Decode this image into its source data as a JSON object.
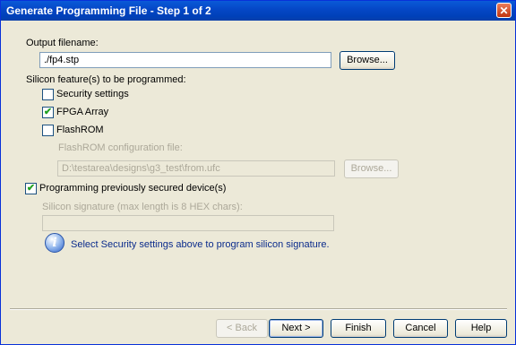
{
  "window": {
    "title": "Generate Programming File - Step 1 of 2",
    "close_glyph": "✕"
  },
  "output": {
    "label": "Output filename:",
    "value": "./fp4.stp",
    "browse_label": "Browse..."
  },
  "features": {
    "label": "Silicon feature(s) to be programmed:",
    "security": {
      "label": "Security settings",
      "checked": false
    },
    "fpga": {
      "label": "FPGA Array",
      "checked": true
    },
    "flashrom": {
      "label": "FlashROM",
      "checked": false
    }
  },
  "flashrom_config": {
    "label": "FlashROM configuration file:",
    "value": "D:\\testarea\\designs\\g3_test\\from.ufc",
    "browse_label": "Browse..."
  },
  "secured": {
    "label": "Programming previously secured device(s)",
    "checked": true
  },
  "signature": {
    "label": "Silicon signature (max length is 8 HEX chars):",
    "value": ""
  },
  "info": {
    "icon": "i",
    "text": "Select Security settings above to program silicon signature."
  },
  "buttons": {
    "back": "< Back",
    "next": "Next >",
    "finish": "Finish",
    "cancel": "Cancel",
    "help": "Help"
  },
  "check_glyph": "✔"
}
